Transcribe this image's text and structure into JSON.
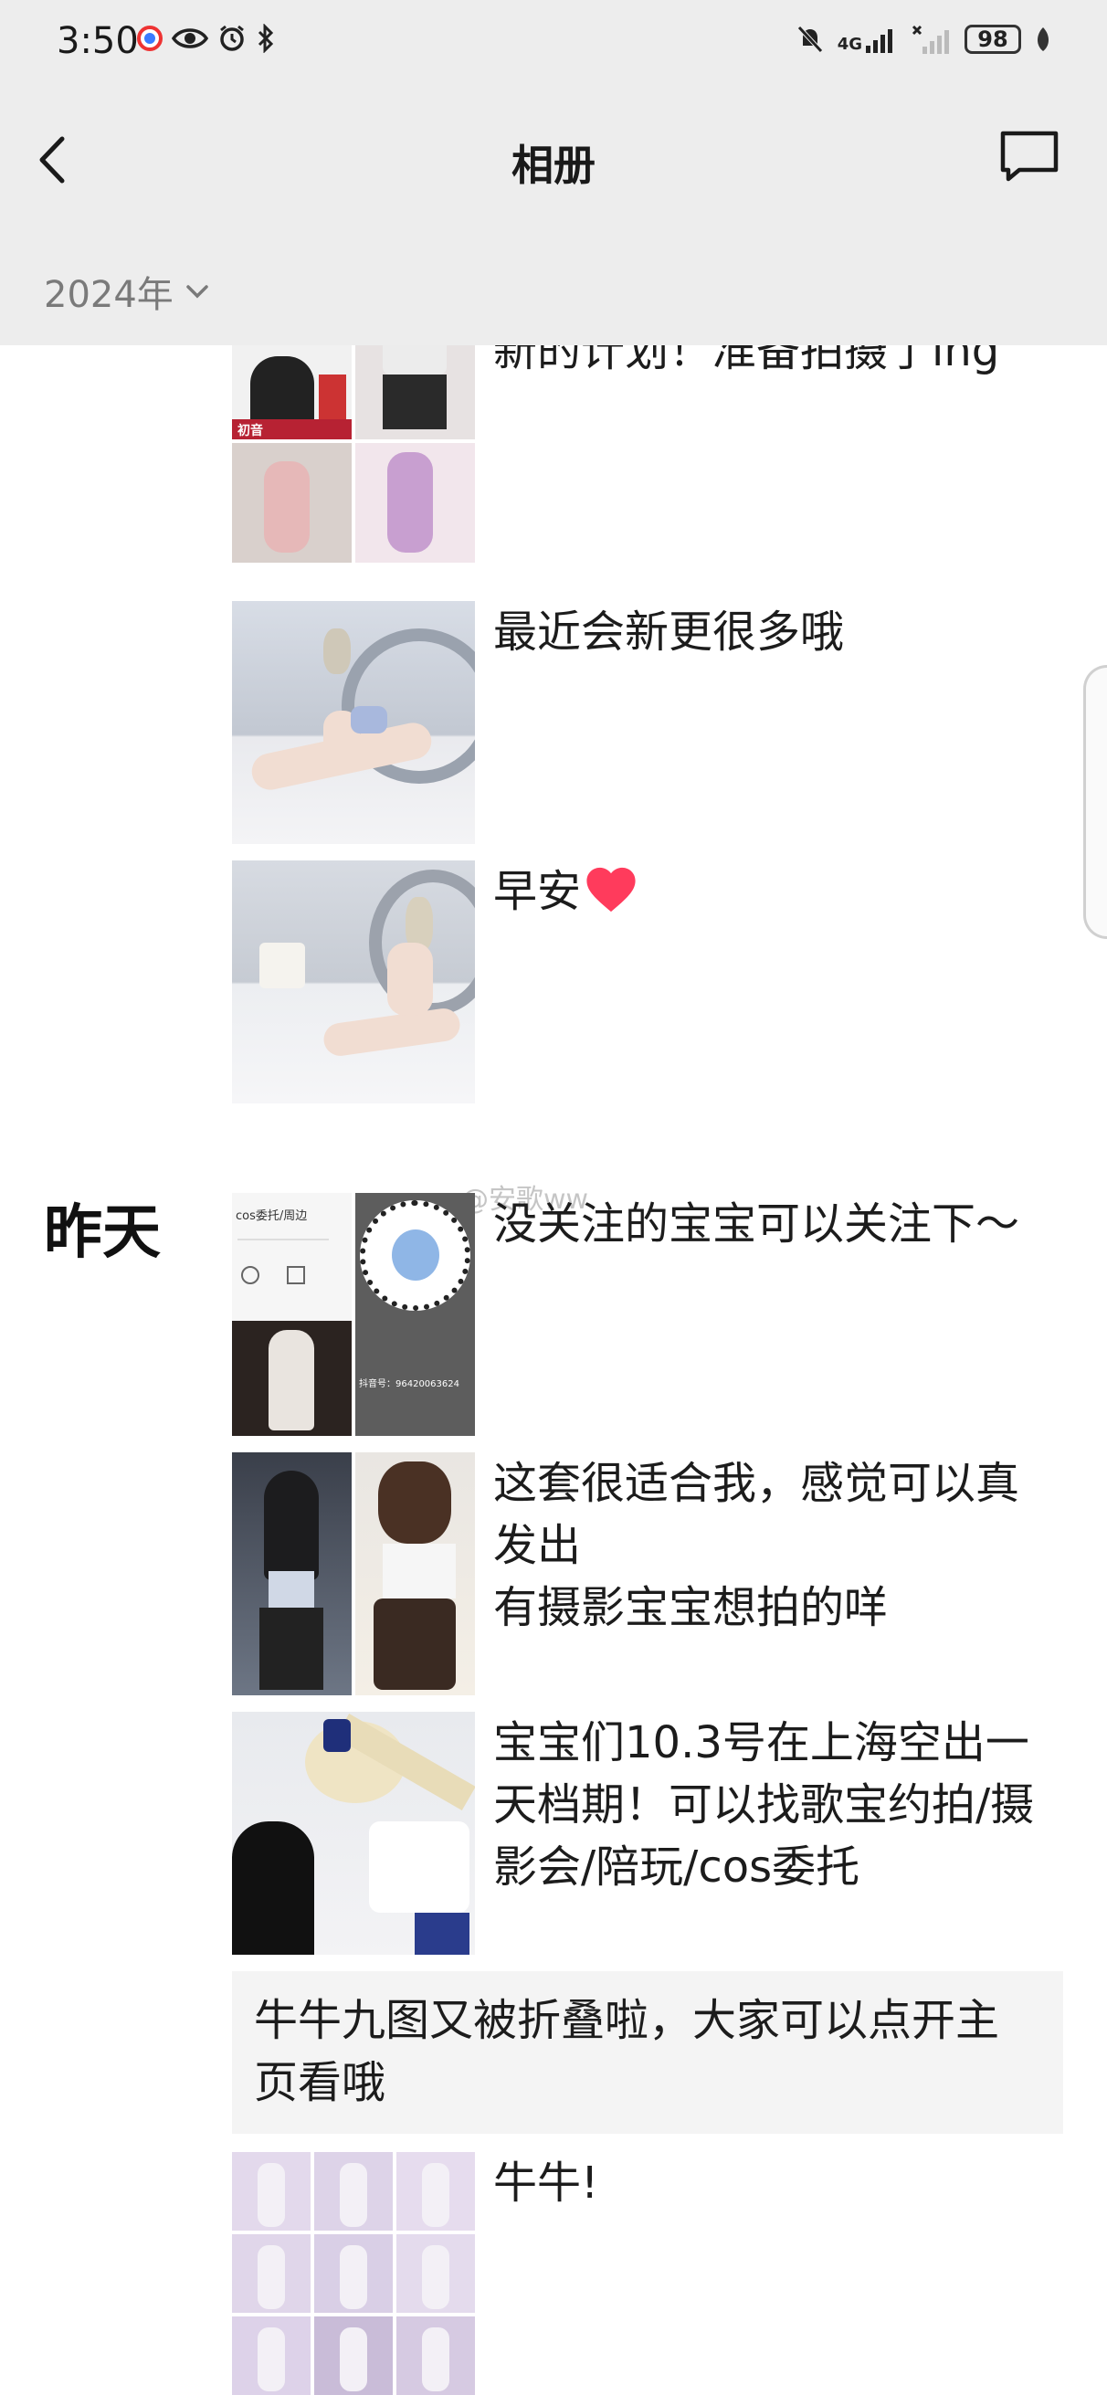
{
  "status_bar": {
    "time": "3:50",
    "network": "4G",
    "battery": "98"
  },
  "nav": {
    "title": "相册"
  },
  "year_filter": {
    "label": "2024年"
  },
  "sections": {
    "yesterday_label": "昨天"
  },
  "posts": [
    {
      "caption": "新的计划！准备拍摄了ing"
    },
    {
      "caption": "最近会新更很多哦"
    },
    {
      "caption": "早安"
    },
    {
      "caption": "没关注的宝宝可以关注下～"
    },
    {
      "caption": "这套很适合我，感觉可以真发出\n有摄影宝宝想拍的咩"
    },
    {
      "caption": "宝宝们10.3号在上海空出一天档期！可以找歌宝约拍/摄影会/陪玩/cos委托"
    },
    {
      "caption": "牛牛九图又被折叠啦，大家可以点开主页看哦"
    },
    {
      "caption": "牛牛!"
    }
  ],
  "thumb_texts": {
    "post1_tile1": "初音",
    "post4_header": "cos委托/周边",
    "post4_id": "抖音号：96420063624",
    "watermark": "@安歌ww"
  },
  "colors": {
    "header_bg": "#ededed",
    "text_post_bg": "#f4f4f4",
    "heart": "#ff3b5c"
  }
}
